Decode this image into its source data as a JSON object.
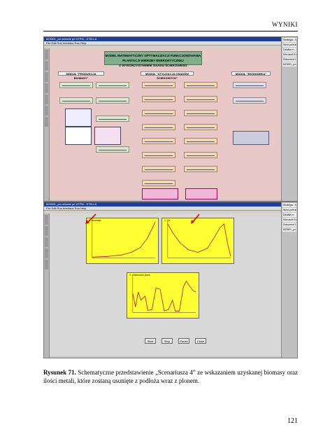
{
  "header": {
    "section_title": "WYNIKI"
  },
  "screenshot_top": {
    "window_title": "MODEL_po zmianie pri UTPM - STELLA",
    "menu": "File  Edit  Run  Interface  Run  Help",
    "banner_line1": "MODEL MATEMATYCZNY OPTYMALIZACJI FUNKCJONOWANIA PLANTACJI WIERZBY ENERGETYCZNEJ",
    "banner_line2": "Z WYKORZYSTANIEM OSADU ŚCIEKOWEGO",
    "module1": "MODUŁ \"PRODUKCJA BIOMASY\"",
    "module2": "MODUŁ \"UTYLIZACJA OSADÓW ŚCIEKOWYCH\"",
    "module3": "MODUŁ \"EKONOMIKA\"",
    "taskbar": [
      "Strategia - Mic",
      "Wzór-pobranie",
      "Działka m - Dok",
      "Microsoft Ex",
      "Dokument 1",
      "MODEL_po..."
    ]
  },
  "screenshot_bottom": {
    "window_title": "MODEL_po zmianie pri UTPM - STELLA",
    "graph1_title": "1: Biomasa",
    "graph2_title": "1: Cd",
    "graph3_title": "1: zmienność plonu",
    "buttons": [
      "Start",
      "Stop",
      "Pause",
      "Close"
    ],
    "taskbar": [
      "Strategia - Mic",
      "Wzór-pobranie",
      "Działka m",
      "Microsoft Ex",
      "Dokument 1",
      "MODEL_po..."
    ]
  },
  "caption": {
    "label": "Rysunek 71.",
    "text": " Schematyczne przedstawienie „Scenariusza 4” ze wskazaniem uzyskanej biomasy oraz ilości metali, które zostaną usunięte z podłoża wraz z plonem."
  },
  "page_number": "121"
}
